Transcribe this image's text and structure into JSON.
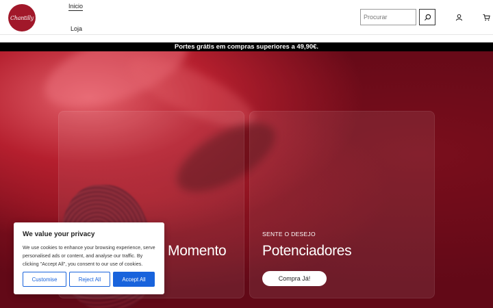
{
  "header": {
    "logo_text": "Chantilly",
    "nav": [
      {
        "label": "Inicio"
      },
      {
        "label": "Loja"
      }
    ],
    "search": {
      "placeholder": "Procurar",
      "value": ""
    },
    "icons": {
      "search": "search-icon",
      "account": "user-icon",
      "cart": "cart-icon"
    }
  },
  "announcement": {
    "text": "Portes grátis em compras superiores a 49,90€."
  },
  "hero": {
    "cards": [
      {
        "eyebrow": "",
        "title": "Momento",
        "button": ""
      },
      {
        "eyebrow": "SENTE O DESEJO",
        "title": "Potenciadores",
        "button": "Compra Já!"
      }
    ]
  },
  "cookie_banner": {
    "title": "We value your privacy",
    "text": "We use cookies to enhance your browsing experience, serve personalised ads or content, and analyse our traffic. By clicking \"Accept All\", you consent to our use of cookies.",
    "buttons": {
      "customise": "Customise",
      "reject": "Reject All",
      "accept": "Accept All"
    }
  },
  "colors": {
    "brand": "#a1182a",
    "accent_button": "#1863dc",
    "hero_bg": "#7d0f1d"
  }
}
